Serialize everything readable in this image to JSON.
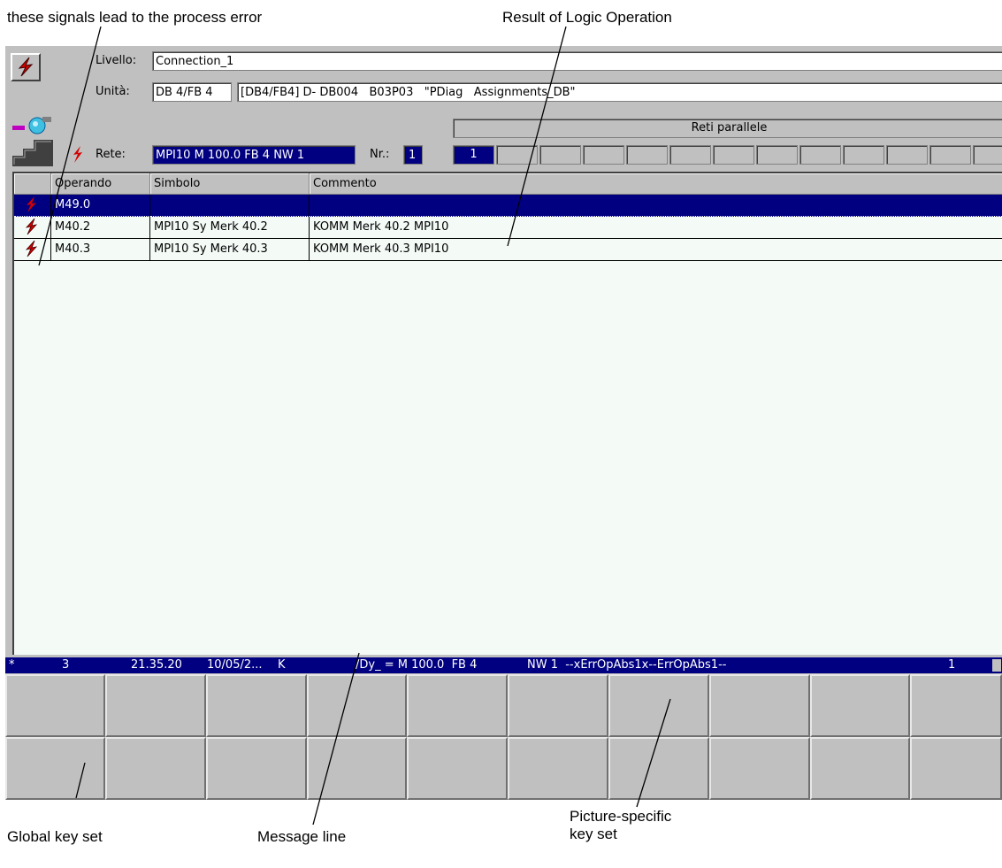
{
  "callouts": {
    "signals": "these signals lead to the process error",
    "rlo": "Result of Logic Operation",
    "global_keys": "Global key set",
    "message_line": "Message line",
    "picture_keys_line1": "Picture-specific",
    "picture_keys_line2": "key set"
  },
  "header": {
    "level_label": "Livello:",
    "level_value": "Connection_1",
    "unit_label": "Unità:",
    "unit_value": "DB 4/FB 4",
    "unit_desc": "[DB4/FB4] D- DB004   B03P03   \"PDiag   Assignments_DB\"",
    "network_label": "Rete:",
    "network_value": "MPI10 M 100.0  FB 4 NW 1",
    "nr_label": "Nr.:",
    "nr_value": "1",
    "parallel_label": "Reti parallele",
    "parallel_selected": "1"
  },
  "table": {
    "columns": [
      "Operando",
      "Simbolo",
      "Commento"
    ],
    "rows": [
      {
        "operand": "M49.0",
        "symbol": "",
        "comment": "",
        "selected": true
      },
      {
        "operand": "M40.2",
        "symbol": "MPI10 Sy Merk 40.2",
        "comment": "KOMM Merk 40.2 MPI10",
        "selected": false
      },
      {
        "operand": "M40.3",
        "symbol": "MPI10 Sy Merk 40.3",
        "comment": "KOMM Merk 40.3 MPI10",
        "selected": false
      }
    ]
  },
  "message": {
    "star": "*",
    "count": "3",
    "time": "21.35.20",
    "date": "10/05/2...",
    "type": "K",
    "text1": "/Dy_ = M 100.0  FB 4",
    "text2": "NW 1  --xErrOpAbs1x--ErrOpAbs1--",
    "number": "1"
  },
  "colors": {
    "selection": "#000080",
    "panel": "#c0c0c0",
    "table_bg": "#f4fbf7",
    "error_icon": "#d40000"
  },
  "icons": [
    "error-bolt-icon",
    "plant-overview-icon"
  ]
}
